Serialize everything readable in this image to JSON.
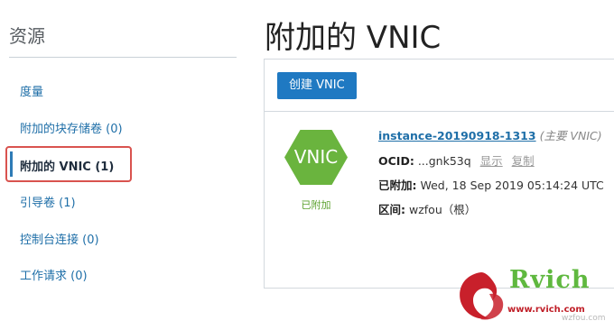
{
  "sidebar": {
    "title": "资源",
    "items": [
      {
        "label": "度量"
      },
      {
        "label": "附加的块存储卷 (0)"
      },
      {
        "label": "附加的 VNIC (1)"
      },
      {
        "label": "引导卷 (1)"
      },
      {
        "label": "控制台连接 (0)"
      },
      {
        "label": "工作请求 (0)"
      }
    ],
    "active_index": 2
  },
  "main": {
    "title": "附加的 VNIC",
    "create_button": "创建 VNIC",
    "vnic": {
      "icon_text": "VNIC",
      "status": "已附加",
      "instance_name": "instance-20190918-1313",
      "primary_tag": "(主要 VNIC)",
      "ocid_label": "OCID:",
      "ocid_value": "...gnk53q",
      "show_link": "显示",
      "copy_link": "复制",
      "attached_label": "已附加:",
      "attached_value": "Wed, 18 Sep 2019 05:14:24 UTC",
      "subnet_label": "区间:",
      "subnet_value": "wzfou（根）"
    }
  },
  "watermark": {
    "brand": "Rvich",
    "url": "www.rvich.com",
    "sub": "wzfou.com"
  },
  "colors": {
    "link": "#1f6fa8",
    "primary_button": "#1f79c2",
    "status_green": "#5aa02c",
    "hex_green": "#6ab43e",
    "highlight_red": "#d9534f"
  }
}
